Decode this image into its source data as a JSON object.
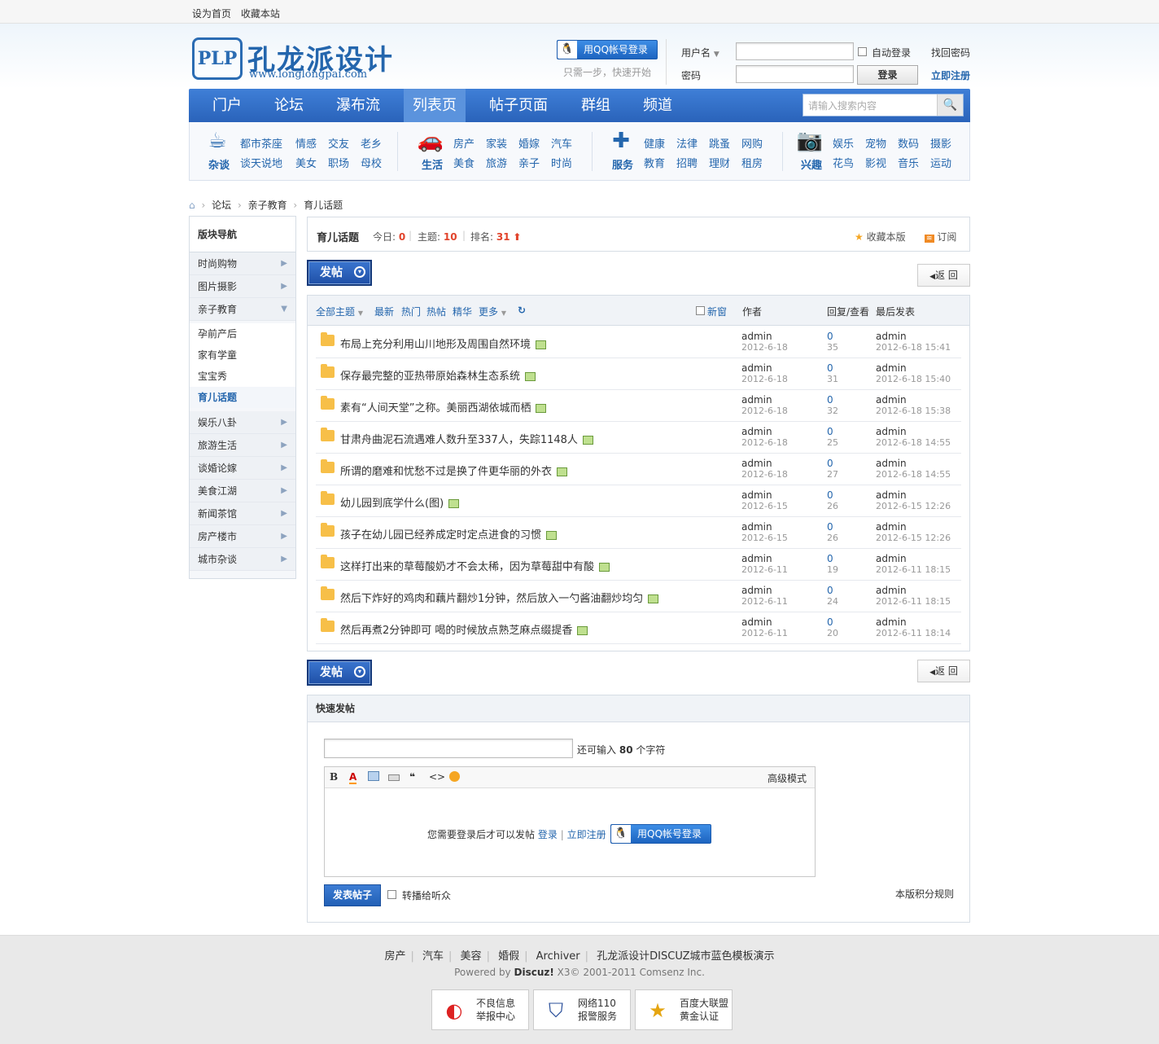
{
  "topbar": {
    "set_home": "设为首页",
    "favorite": "收藏本站"
  },
  "logo": {
    "mark": "PLP",
    "name": "孔龙派设计",
    "url": "www.longlongpai.com"
  },
  "login": {
    "qq_label": "用QQ帐号登录",
    "qq_hint": "只需一步，快速开始",
    "username_label": "用户名",
    "password_label": "密码",
    "auto_login": "自动登录",
    "forgot": "找回密码",
    "register": "立即注册",
    "submit": "登录"
  },
  "nav": {
    "items": [
      "门户",
      "论坛",
      "瀑布流",
      "列表页",
      "帖子页面",
      "群组",
      "频道"
    ],
    "active_index": 3,
    "search_placeholder": "请输入搜索内容"
  },
  "categories": [
    {
      "name": "杂谈",
      "icon": "cup-icon",
      "glyph": "☕",
      "links": [
        "都市茶座",
        "情感",
        "交友",
        "老乡",
        "谈天说地",
        "美女",
        "职场",
        "母校"
      ]
    },
    {
      "name": "生活",
      "icon": "car-icon",
      "glyph": "🚗",
      "links": [
        "房产",
        "家装",
        "婚嫁",
        "汽车",
        "美食",
        "旅游",
        "亲子",
        "时尚"
      ]
    },
    {
      "name": "服务",
      "icon": "medkit-icon",
      "glyph": "✚",
      "links": [
        "健康",
        "法律",
        "跳蚤",
        "网购",
        "教育",
        "招聘",
        "理财",
        "租房"
      ]
    },
    {
      "name": "兴趣",
      "icon": "camera-icon",
      "glyph": "📷",
      "links": [
        "娱乐",
        "宠物",
        "数码",
        "摄影",
        "花鸟",
        "影视",
        "音乐",
        "运动"
      ]
    }
  ],
  "breadcrumb": [
    "论坛",
    "亲子教育",
    "育儿话题"
  ],
  "sidebar": {
    "title": "版块导航",
    "groups_top": [
      "时尚购物",
      "图片摄影",
      "亲子教育"
    ],
    "subs": [
      "孕前产后",
      "家有学童",
      "宝宝秀",
      "育儿话题"
    ],
    "groups_bottom": [
      "娱乐八卦",
      "旅游生活",
      "谈婚论嫁",
      "美食江湖",
      "新闻茶馆",
      "房产楼市",
      "城市杂谈"
    ]
  },
  "forum": {
    "title": "育儿话题",
    "today_label": "今日:",
    "today": "0",
    "threads_label": "主题:",
    "threads": "10",
    "rank_label": "排名:",
    "rank": "31",
    "fav": "收藏本版",
    "rss": "订阅",
    "post_btn": "发帖",
    "back_btn": "返 回"
  },
  "filters": {
    "all": "全部主题",
    "newest": "最新",
    "hot": "热门",
    "hotpost": "热帖",
    "digest": "精华",
    "more": "更多",
    "new_window": "新窗",
    "author": "作者",
    "replies": "回复/查看",
    "last": "最后发表"
  },
  "threads": [
    {
      "title": "布局上充分利用山川地形及周围自然环境",
      "author": "admin",
      "date": "2012-6-18",
      "replies": "0",
      "views": "35",
      "last_user": "admin",
      "last_time": "2012-6-18 15:41"
    },
    {
      "title": "保存最完整的亚热带原始森林生态系统",
      "author": "admin",
      "date": "2012-6-18",
      "replies": "0",
      "views": "31",
      "last_user": "admin",
      "last_time": "2012-6-18 15:40"
    },
    {
      "title": "素有“人间天堂”之称。美丽西湖依城而栖",
      "author": "admin",
      "date": "2012-6-18",
      "replies": "0",
      "views": "32",
      "last_user": "admin",
      "last_time": "2012-6-18 15:38"
    },
    {
      "title": "甘肃舟曲泥石流遇难人数升至337人，失踪1148人",
      "author": "admin",
      "date": "2012-6-18",
      "replies": "0",
      "views": "25",
      "last_user": "admin",
      "last_time": "2012-6-18 14:55"
    },
    {
      "title": "所谓的磨难和忧愁不过是换了件更华丽的外衣",
      "author": "admin",
      "date": "2012-6-18",
      "replies": "0",
      "views": "27",
      "last_user": "admin",
      "last_time": "2012-6-18 14:55"
    },
    {
      "title": "幼儿园到底学什么(图)",
      "author": "admin",
      "date": "2012-6-15",
      "replies": "0",
      "views": "26",
      "last_user": "admin",
      "last_time": "2012-6-15 12:26"
    },
    {
      "title": "孩子在幼儿园已经养成定时定点进食的习惯",
      "author": "admin",
      "date": "2012-6-15",
      "replies": "0",
      "views": "26",
      "last_user": "admin",
      "last_time": "2012-6-15 12:26"
    },
    {
      "title": "这样打出来的草莓酸奶才不会太稀，因为草莓甜中有酸",
      "author": "admin",
      "date": "2012-6-11",
      "replies": "0",
      "views": "19",
      "last_user": "admin",
      "last_time": "2012-6-11 18:15"
    },
    {
      "title": "然后下炸好的鸡肉和藕片翻炒1分钟，然后放入一勺酱油翻炒均匀",
      "author": "admin",
      "date": "2012-6-11",
      "replies": "0",
      "views": "24",
      "last_user": "admin",
      "last_time": "2012-6-11 18:15"
    },
    {
      "title": "然后再煮2分钟即可 喝的时候放点熟芝麻点缀提香",
      "author": "admin",
      "date": "2012-6-11",
      "replies": "0",
      "views": "20",
      "last_user": "admin",
      "last_time": "2012-6-11 18:14"
    }
  ],
  "quickpost": {
    "title": "快速发帖",
    "remain_prefix": "还可输入",
    "remain": "80",
    "remain_suffix": "个字符",
    "advanced": "高级模式",
    "need_login": "您需要登录后才可以发帖",
    "login": "登录",
    "register": "立即注册",
    "qq_label": "用QQ帐号登录",
    "submit": "发表帖子",
    "forward": "转播给听众",
    "rules": "本版积分规则"
  },
  "footer": {
    "links": [
      "房产",
      "汽车",
      "美容",
      "婚假",
      "Archiver",
      "孔龙派设计DISCUZ城市蓝色模板演示"
    ],
    "powered_prefix": "Powered by",
    "powered_brand": "Discuz!",
    "powered_suffix": "X3© 2001-2011 Comsenz Inc.",
    "badges": [
      {
        "line1": "不良信息",
        "line2": "举报中心"
      },
      {
        "line1": "网络110",
        "line2": "报警服务"
      },
      {
        "line1": "百度大联盟",
        "line2": "黄金认证"
      }
    ]
  }
}
